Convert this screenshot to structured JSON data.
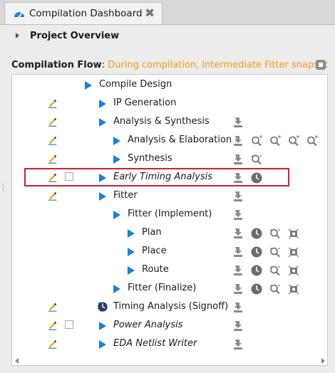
{
  "tab": {
    "title": "Compilation Dashboard",
    "close_glyph": "✖",
    "icon": "dashboard-icon"
  },
  "overview": {
    "title": "Project Overview"
  },
  "flow": {
    "label": "Compilation Flow",
    "colon": ":",
    "message": " During compilation, intermediate Fitter snapsho",
    "message_color": "#f29a12"
  },
  "highlight_color": "#d2202a",
  "play_color": "#1a83d6",
  "rows": [
    {
      "label": "Compile Design",
      "italic": false,
      "indent": 0,
      "pencil": false,
      "checkbox": false,
      "icons": []
    },
    {
      "label": "IP Generation",
      "italic": false,
      "indent": 1,
      "pencil": true,
      "checkbox": false,
      "icons": []
    },
    {
      "label": "Analysis & Synthesis",
      "italic": false,
      "indent": 1,
      "pencil": true,
      "checkbox": false,
      "icons": [
        "report"
      ]
    },
    {
      "label": "Analysis & Elaboration",
      "italic": false,
      "indent": 2,
      "pencil": true,
      "checkbox": false,
      "icons": [
        "report",
        "snapshot",
        "snapshot",
        "snapshot",
        "snapshot"
      ]
    },
    {
      "label": "Synthesis",
      "italic": false,
      "indent": 2,
      "pencil": true,
      "checkbox": false,
      "icons": [
        "report",
        "netlist"
      ]
    },
    {
      "label": "Early Timing Analysis",
      "italic": true,
      "indent": 1,
      "pencil": true,
      "checkbox": true,
      "icons": [
        "report",
        "clock"
      ]
    },
    {
      "label": "Fitter",
      "italic": false,
      "indent": 1,
      "pencil": true,
      "checkbox": false,
      "icons": [
        "report"
      ]
    },
    {
      "label": "Fitter (Implement)",
      "italic": false,
      "indent": 2,
      "pencil": false,
      "checkbox": false,
      "icons": [
        "report"
      ]
    },
    {
      "label": "Plan",
      "italic": false,
      "indent": 3,
      "pencil": false,
      "checkbox": false,
      "icons": [
        "report",
        "clock",
        "netlist",
        "chip"
      ]
    },
    {
      "label": "Place",
      "italic": false,
      "indent": 3,
      "pencil": false,
      "checkbox": false,
      "icons": [
        "report",
        "clock",
        "netlist",
        "chip"
      ]
    },
    {
      "label": "Route",
      "italic": false,
      "indent": 3,
      "pencil": false,
      "checkbox": false,
      "icons": [
        "report",
        "clock",
        "netlist",
        "chip"
      ]
    },
    {
      "label": "Fitter (Finalize)",
      "italic": false,
      "indent": 2,
      "pencil": false,
      "checkbox": false,
      "icons": [
        "report",
        "clock",
        "netlist",
        "chip"
      ]
    },
    {
      "label": "Timing Analysis (Signoff)",
      "italic": false,
      "indent": 1,
      "pencil": true,
      "checkbox": false,
      "status": "timing-clock",
      "icons": [
        "report"
      ]
    },
    {
      "label": "Power Analysis",
      "italic": true,
      "indent": 1,
      "pencil": true,
      "checkbox": true,
      "icons": [
        "report"
      ]
    },
    {
      "label": "EDA Netlist Writer",
      "italic": true,
      "indent": 1,
      "pencil": true,
      "checkbox": false,
      "icons": [
        "report"
      ]
    }
  ]
}
